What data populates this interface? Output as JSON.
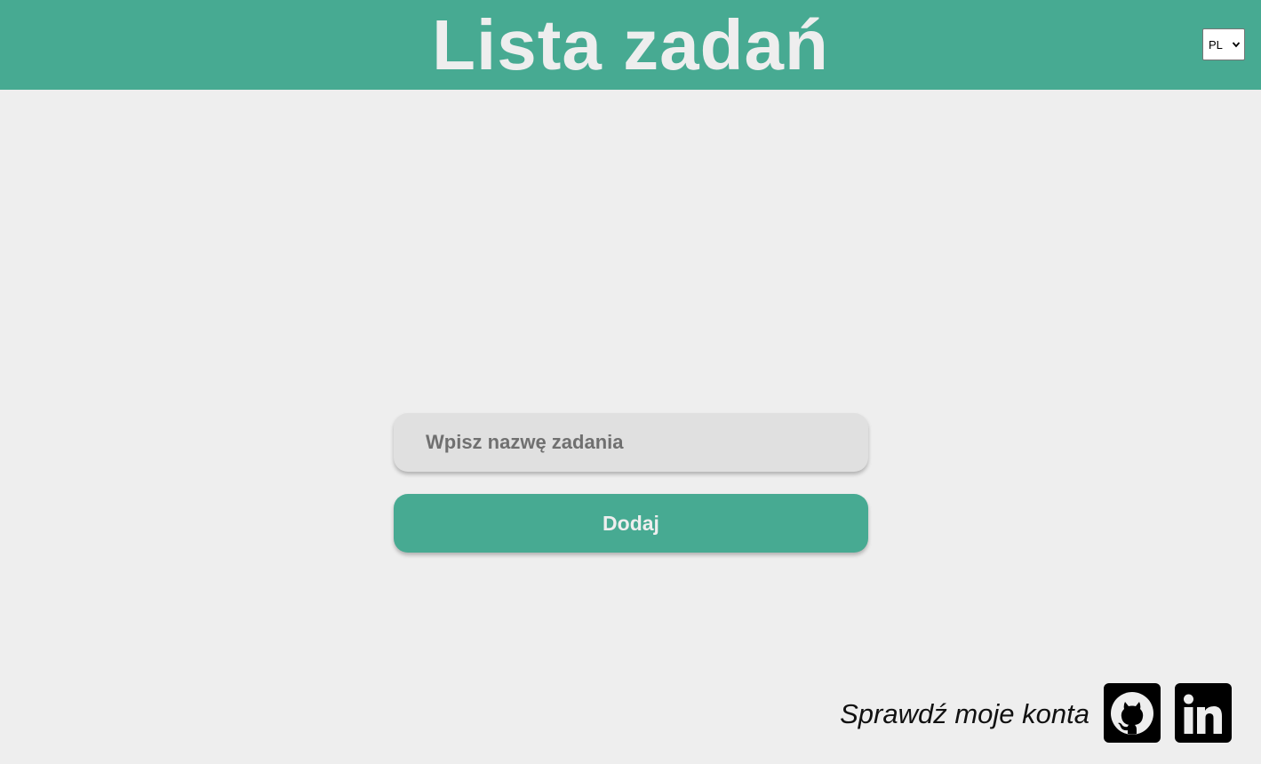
{
  "header": {
    "title": "Lista zadań",
    "language": {
      "selected": "PL"
    }
  },
  "form": {
    "task_input_placeholder": "Wpisz nazwę zadania",
    "add_button_label": "Dodaj"
  },
  "footer": {
    "text": "Sprawdź moje konta",
    "links": [
      {
        "icon": "github-icon"
      },
      {
        "icon": "linkedin-icon"
      }
    ]
  },
  "colors": {
    "accent": "#47aa92",
    "background": "#eeeeee",
    "input_background": "#e0e0e0"
  }
}
